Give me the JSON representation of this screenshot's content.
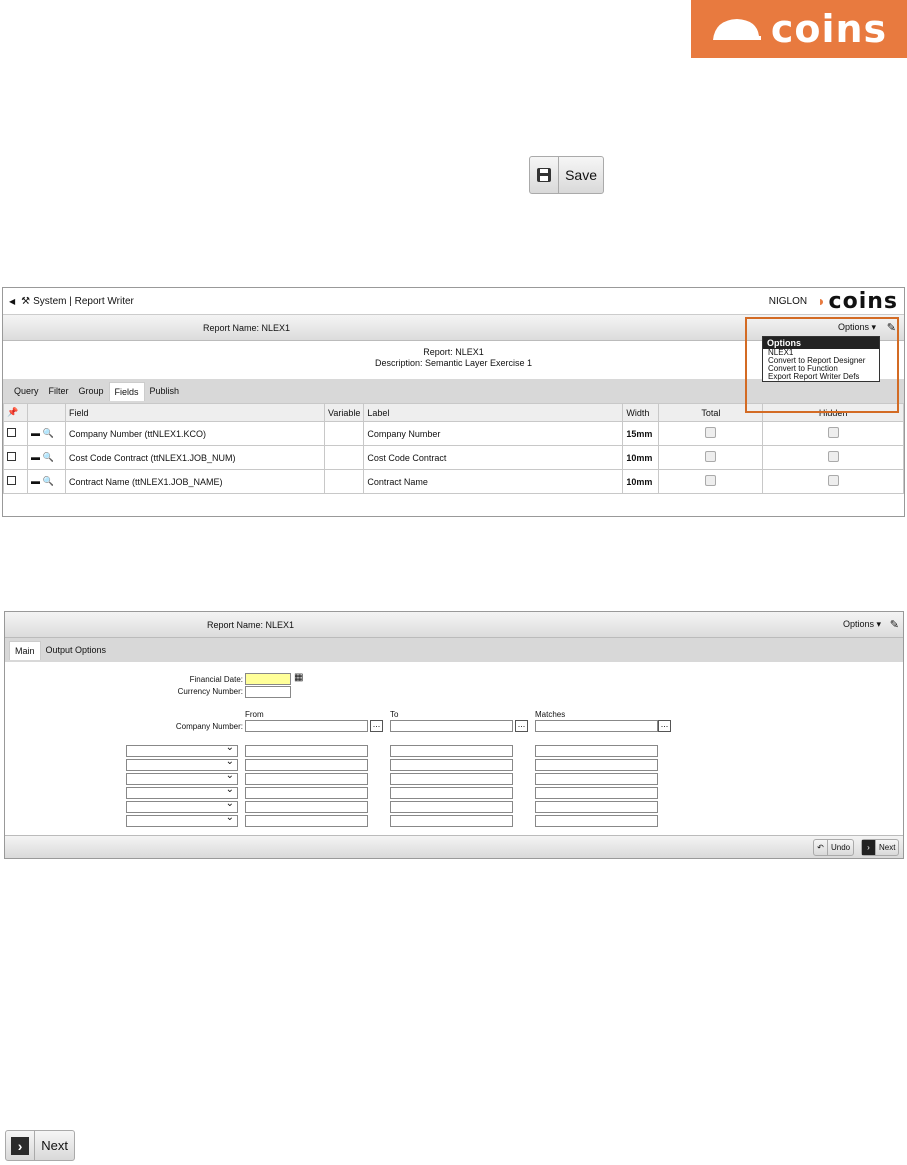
{
  "logo": {
    "text": "coins"
  },
  "save_button": {
    "label": "Save"
  },
  "shot1": {
    "breadcrumb": "System | Report Writer",
    "user": "NIGLON",
    "brand": "coins",
    "report_name": "Report Name: NLEX1",
    "options_label": "Options",
    "report": "Report: NLEX1",
    "description": "Description: Semantic Layer Exercise 1",
    "tabs": [
      "Query",
      "Filter",
      "Group",
      "Fields",
      "Publish"
    ],
    "columns": {
      "field": "Field",
      "variable": "Variable",
      "label": "Label",
      "width": "Width",
      "total": "Total",
      "hidden": "Hidden"
    },
    "rows": [
      {
        "field": "Company Number (ttNLEX1.KCO)",
        "label": "Company Number",
        "width": "15mm"
      },
      {
        "field": "Cost Code Contract (ttNLEX1.JOB_NUM)",
        "label": "Cost Code Contract",
        "width": "10mm"
      },
      {
        "field": "Contract Name (ttNLEX1.JOB_NAME)",
        "label": "Contract Name",
        "width": "10mm"
      }
    ],
    "menu": {
      "header": "Options",
      "items": [
        "NLEX1",
        "Convert to Report Designer",
        "Convert to Function",
        "Export Report Writer Defs"
      ]
    }
  },
  "shot2": {
    "report_name": "Report Name: NLEX1",
    "options_label": "Options",
    "tabs": [
      "Main",
      "Output Options"
    ],
    "financial_date": "Financial Date:",
    "currency_number": "Currency Number:",
    "company_number": "Company Number:",
    "from": "From",
    "to": "To",
    "matches": "Matches",
    "undo": "Undo",
    "next": "Next"
  },
  "next_button": {
    "label": "Next"
  },
  "colors": {
    "accent": "#e87a3f",
    "highlight": "#d36b24",
    "input_yellow": "#ffff99"
  }
}
